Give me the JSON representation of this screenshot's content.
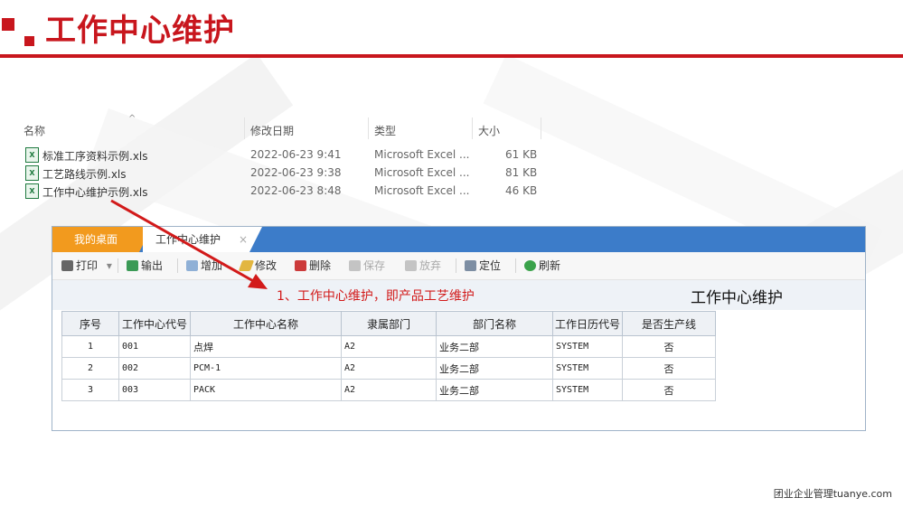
{
  "slide": {
    "title": "工作中心维护",
    "accent_color": "#c8161d",
    "footer": "团业企业管理tuanye.com"
  },
  "explorer": {
    "columns": {
      "name": "名称",
      "modified": "修改日期",
      "type": "类型",
      "size": "大小"
    },
    "files": [
      {
        "icon": "excel-file-icon",
        "name": "标准工序资料示例.xls",
        "modified": "2022-06-23 9:41",
        "type": "Microsoft Excel ...",
        "size": "61 KB"
      },
      {
        "icon": "excel-file-icon",
        "name": "工艺路线示例.xls",
        "modified": "2022-06-23 9:38",
        "type": "Microsoft Excel ...",
        "size": "81 KB"
      },
      {
        "icon": "excel-file-icon",
        "name": "工作中心维护示例.xls",
        "modified": "2022-06-23 8:48",
        "type": "Microsoft Excel ...",
        "size": "46 KB"
      }
    ]
  },
  "app": {
    "tabs": [
      {
        "label": "我的桌面"
      },
      {
        "label": "工作中心维护",
        "close": "×"
      }
    ],
    "toolbar": {
      "print": "打印",
      "print_dropdown": "▾",
      "export": "输出",
      "add": "增加",
      "edit": "修改",
      "delete": "删除",
      "save": "保存",
      "discard": "放弃",
      "locate": "定位",
      "refresh": "刷新"
    },
    "annotation": "1、工作中心维护，即产品工艺维护",
    "panel_title": "工作中心维护",
    "grid": {
      "headers": [
        "序号",
        "工作中心代号",
        "工作中心名称",
        "隶属部门",
        "部门名称",
        "工作日历代号",
        "是否生产线"
      ],
      "rows": [
        [
          "1",
          "001",
          "点焊",
          "A2",
          "业务二部",
          "SYSTEM",
          "否"
        ],
        [
          "2",
          "002",
          "PCM-1",
          "A2",
          "业务二部",
          "SYSTEM",
          "否"
        ],
        [
          "3",
          "003",
          "PACK",
          "A2",
          "业务二部",
          "SYSTEM",
          "否"
        ]
      ]
    }
  }
}
